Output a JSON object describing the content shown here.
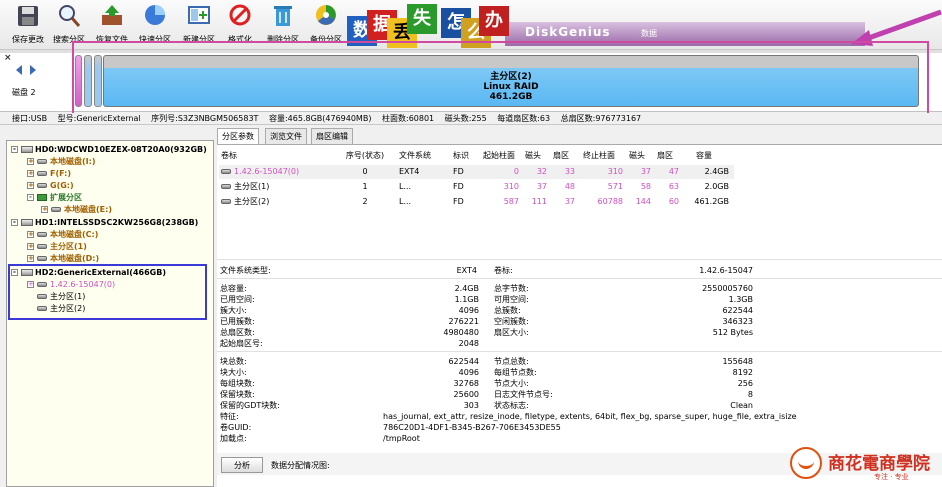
{
  "toolbar": {
    "items": [
      {
        "label": "保存更改",
        "icon": "save-icon"
      },
      {
        "label": "搜索分区",
        "icon": "search-icon"
      },
      {
        "label": "恢复文件",
        "icon": "recover-icon"
      },
      {
        "label": "快速分区",
        "icon": "quick-partition-icon"
      },
      {
        "label": "新建分区",
        "icon": "new-partition-icon"
      },
      {
        "label": "格式化",
        "icon": "format-icon"
      },
      {
        "label": "删除分区",
        "icon": "delete-icon"
      },
      {
        "label": "备份分区",
        "icon": "backup-icon"
      }
    ]
  },
  "banner": {
    "tiles": [
      "数",
      "据",
      "丢",
      "失",
      "怎",
      "么",
      "办"
    ],
    "brand": "DiskGenius",
    "brand2": "数据"
  },
  "diskmap": {
    "close_symbol": "×",
    "disk_label": "磁盘 2",
    "main_partition": {
      "name": "主分区(2)",
      "fs": "Linux RAID",
      "size": "461.2GB"
    }
  },
  "infobar": [
    "接口:USB",
    "型号:GenericExternal",
    "序列号:S3Z3NBGM506583T",
    "容量:465.8GB(476940MB)",
    "柱面数:60801",
    "磁头数:255",
    "每道扇区数:63",
    "总扇区数:976773167"
  ],
  "tree": {
    "nodes": [
      {
        "text": "HD0:WDCWD10EZEX-08T20A0(932GB)",
        "expand": "-"
      },
      {
        "text": "本地磁盘(I:)",
        "expand": "+"
      },
      {
        "text": "F(F:)",
        "expand": "+"
      },
      {
        "text": "G(G:)",
        "expand": "+"
      },
      {
        "text": "扩展分区",
        "expand": "-"
      },
      {
        "text": "本地磁盘(E:)",
        "expand": "+"
      },
      {
        "text": "HD1:INTELSSDSC2KW256G8(238GB)",
        "expand": "-"
      },
      {
        "text": "本地磁盘(C:)",
        "expand": "+"
      },
      {
        "text": "主分区(1)",
        "expand": "+"
      },
      {
        "text": "本地磁盘(D:)",
        "expand": "+"
      },
      {
        "text": "HD2:GenericExternal(466GB)",
        "expand": "-"
      },
      {
        "text": "1.42.6-15047(0)",
        "expand": "+"
      },
      {
        "text": "主分区(1)",
        "expand": ""
      },
      {
        "text": "主分区(2)",
        "expand": ""
      }
    ]
  },
  "tabs": [
    "分区参数",
    "浏览文件",
    "扇区编辑"
  ],
  "partition_table": {
    "headers": [
      "卷标",
      "序号(状态)",
      "文件系统",
      "标识",
      "起始柱面",
      "磁头",
      "扇区",
      "终止柱面",
      "磁头",
      "扇区",
      "容量"
    ],
    "rows": [
      {
        "name": "1.42.6-15047(0)",
        "num": "0",
        "fs": "EXT4",
        "flag": "FD",
        "sc": "0",
        "sh": "32",
        "ss": "33",
        "ec": "310",
        "eh": "37",
        "es": "47",
        "cap": "2.4GB"
      },
      {
        "name": "主分区(1)",
        "num": "1",
        "fs": "L...",
        "flag": "FD",
        "sc": "310",
        "sh": "37",
        "ss": "48",
        "ec": "571",
        "eh": "58",
        "es": "63",
        "cap": "2.0GB"
      },
      {
        "name": "主分区(2)",
        "num": "2",
        "fs": "L...",
        "flag": "FD",
        "sc": "587",
        "sh": "111",
        "ss": "37",
        "ec": "60788",
        "eh": "144",
        "es": "60",
        "cap": "461.2GB"
      }
    ]
  },
  "details": {
    "fs_type": {
      "label": "文件系统类型:",
      "value": "EXT4"
    },
    "volume": {
      "label": "卷标:",
      "value": "1.42.6-15047"
    },
    "left_group": [
      {
        "label": "总容量:",
        "value": "2.4GB"
      },
      {
        "label": "已用空间:",
        "value": "1.1GB"
      },
      {
        "label": "簇大小:",
        "value": "4096"
      },
      {
        "label": "已用簇数:",
        "value": "276221"
      },
      {
        "label": "总扇区数:",
        "value": "4980480"
      },
      {
        "label": "起始扇区号:",
        "value": "2048"
      }
    ],
    "right_group": [
      {
        "label": "总字节数:",
        "value": "2550005760"
      },
      {
        "label": "可用空间:",
        "value": "1.3GB"
      },
      {
        "label": "总簇数:",
        "value": "622544"
      },
      {
        "label": "空闲簇数:",
        "value": "346323"
      },
      {
        "label": "扇区大小:",
        "value": "512 Bytes"
      }
    ],
    "left_group2": [
      {
        "label": "块总数:",
        "value": "622544"
      },
      {
        "label": "块大小:",
        "value": "4096"
      },
      {
        "label": "每组块数:",
        "value": "32768"
      },
      {
        "label": "保留块数:",
        "value": "25600"
      },
      {
        "label": "保留的GDT块数:",
        "value": "303"
      }
    ],
    "right_group2": [
      {
        "label": "节点总数:",
        "value": "155648"
      },
      {
        "label": "每组节点数:",
        "value": "8192"
      },
      {
        "label": "节点大小:",
        "value": "256"
      },
      {
        "label": "日志文件节点号:",
        "value": "8"
      },
      {
        "label": "状态标志:",
        "value": "Clean"
      }
    ],
    "features": {
      "label": "特征:",
      "value": "has_journal, ext_attr, resize_inode, filetype, extents, 64bit, flex_bg, sparse_super, huge_file, extra_isize"
    },
    "guid": {
      "label": "卷GUID:",
      "value": "786C20D1-4DF1-B345-B267-706E3453DE55"
    },
    "mount": {
      "label": "加载点:",
      "value": "/tmpRoot"
    }
  },
  "analysis": {
    "button": "分析",
    "label": "数据分配情况图:"
  },
  "watermark": {
    "title": "商花電商學院",
    "sub": "专注 · 专业"
  },
  "colors": {
    "accent_pink": "#d050c0",
    "marker_pink": "#d04aa0",
    "marker_blue": "#3a3ad8",
    "partition_blue": "#5ab8f2"
  }
}
